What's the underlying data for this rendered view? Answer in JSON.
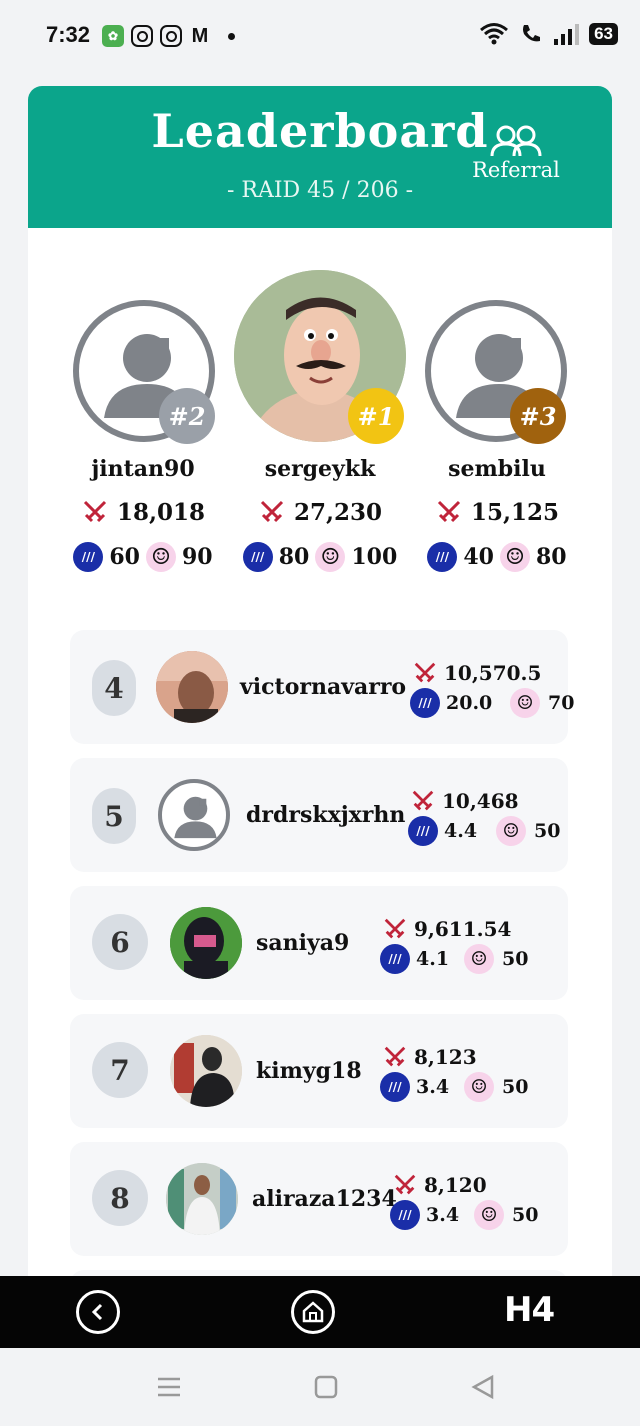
{
  "status_bar": {
    "time": "7:32",
    "battery": "63",
    "notif_icons": [
      "app-icon",
      "instagram-icon",
      "instagram-icon",
      "gmail-icon"
    ]
  },
  "header": {
    "title": "Leaderboard",
    "subtitle": "- RAID 45 / 206 -",
    "referral_label": "Referral",
    "color": "#0ba58b"
  },
  "podium": [
    {
      "rank": "#2",
      "name": "jintan90",
      "score": "18,018",
      "steem": "60",
      "mascot": "90",
      "badge_color": "#9aa0a8"
    },
    {
      "rank": "#1",
      "name": "sergeykk",
      "score": "27,230",
      "steem": "80",
      "mascot": "100",
      "badge_color": "#f2c413"
    },
    {
      "rank": "#3",
      "name": "sembilu",
      "score": "15,125",
      "steem": "40",
      "mascot": "80",
      "badge_color": "#a0620e"
    }
  ],
  "rows": [
    {
      "rank": "4",
      "name": "victornavarro",
      "score": "10,570.5",
      "steem": "20.0",
      "mascot": "70"
    },
    {
      "rank": "5",
      "name": "drdrskxjxrhn",
      "score": "10,468",
      "steem": "4.4",
      "mascot": "50"
    },
    {
      "rank": "6",
      "name": "saniya9",
      "score": "9,611.54",
      "steem": "4.1",
      "mascot": "50"
    },
    {
      "rank": "7",
      "name": "kimyg18",
      "score": "8,123",
      "steem": "3.4",
      "mascot": "50"
    },
    {
      "rank": "8",
      "name": "aliraza1234",
      "score": "8,120",
      "steem": "3.4",
      "mascot": "50"
    }
  ],
  "bottom_bar": {
    "brand": "H4"
  }
}
